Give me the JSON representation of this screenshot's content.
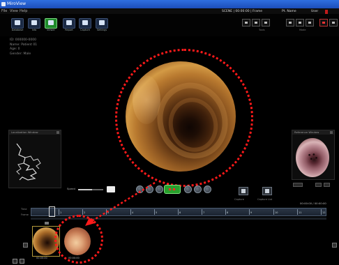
{
  "window": {
    "title": "MiroView"
  },
  "menu": {
    "items": [
      "File",
      "View",
      "Help"
    ]
  },
  "toolbar": {
    "buttons": [
      {
        "label": "Database"
      },
      {
        "label": "Info"
      },
      {
        "label": "Viewer"
      },
      {
        "label": "Report"
      },
      {
        "label": "Capture"
      },
      {
        "label": "Settings"
      }
    ]
  },
  "status": {
    "left": "SCENE | 00:00:00 | Frame",
    "middle": "Pt. Name",
    "right": "User"
  },
  "top_controls": {
    "group1_caption": "Tools",
    "group2_caption": "Mode"
  },
  "patient": {
    "lines": [
      "ID: 000000-0000",
      "Name: Patient 01",
      "Age: 0",
      "Gender: Male"
    ]
  },
  "panels": {
    "track_header": "Localization Window",
    "pip_header": "Reference Window"
  },
  "playbar": {
    "speed_label": "Speed",
    "speed_level": 0.55,
    "capture_label_1": "Capture",
    "capture_label_2": "Capture List"
  },
  "timeline": {
    "top_text": "00:00:00 / 00:00:00",
    "row1_label": "Time",
    "row2_label": "Frame",
    "ticks": [
      "1",
      "2",
      "3",
      "4",
      "5",
      "6",
      "7",
      "8",
      "9",
      "10",
      "11",
      "12"
    ]
  },
  "thumbnails": [
    {
      "caption": "00:00:00"
    },
    {
      "caption": "00:00:00"
    }
  ],
  "colors": {
    "accent_green": "#28a02c",
    "annotation_red": "#ff1a1a",
    "titlebar_blue": "#2f6fe0"
  }
}
